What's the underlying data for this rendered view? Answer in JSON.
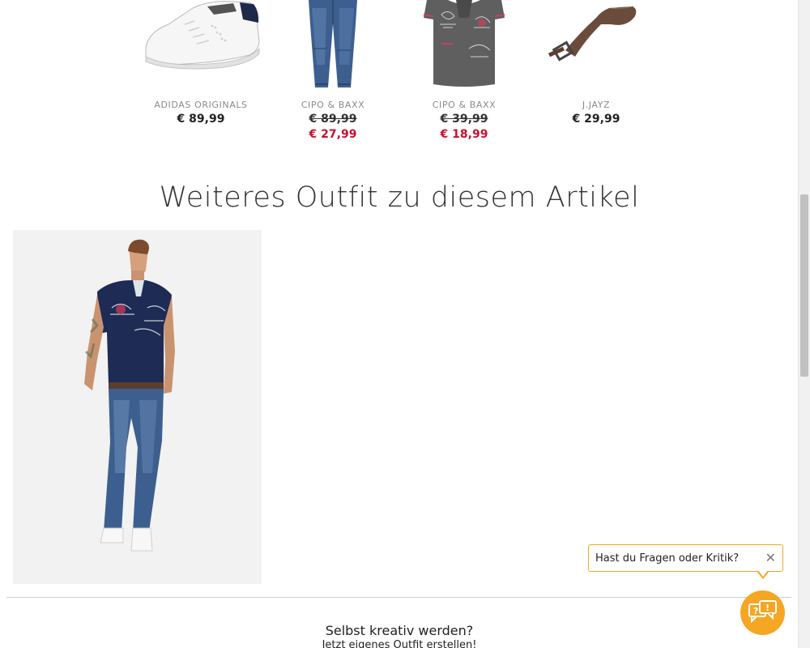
{
  "products": [
    {
      "brand": "ADIDAS ORIGINALS",
      "price": "€ 89,99",
      "sale_price": null,
      "image": "white-sneaker-image"
    },
    {
      "brand": "CIPO & BAXX",
      "price": "€ 89,99",
      "sale_price": "€ 27,99",
      "image": "blue-jeans-image"
    },
    {
      "brand": "CIPO & BAXX",
      "price": "€ 39,99",
      "sale_price": "€ 18,99",
      "image": "grey-polo-shirt-image"
    },
    {
      "brand": "J.JAYZ",
      "price": "€ 29,99",
      "sale_price": null,
      "image": "brown-belt-image"
    }
  ],
  "outfit_section": {
    "title": "Weiteres Outfit zu diesem Artikel",
    "image": "outfit-model-image"
  },
  "creative": {
    "title": "Selbst kreativ werden?",
    "subtitle": "Jetzt eigenes Outfit erstellen!"
  },
  "feedback": {
    "prompt": "Hast du Fragen oder Kritik?",
    "close_icon": "close-icon",
    "button_icon": "feedback-chat-icon"
  },
  "colors": {
    "sale": "#c8102e",
    "accent": "#f5a623"
  }
}
